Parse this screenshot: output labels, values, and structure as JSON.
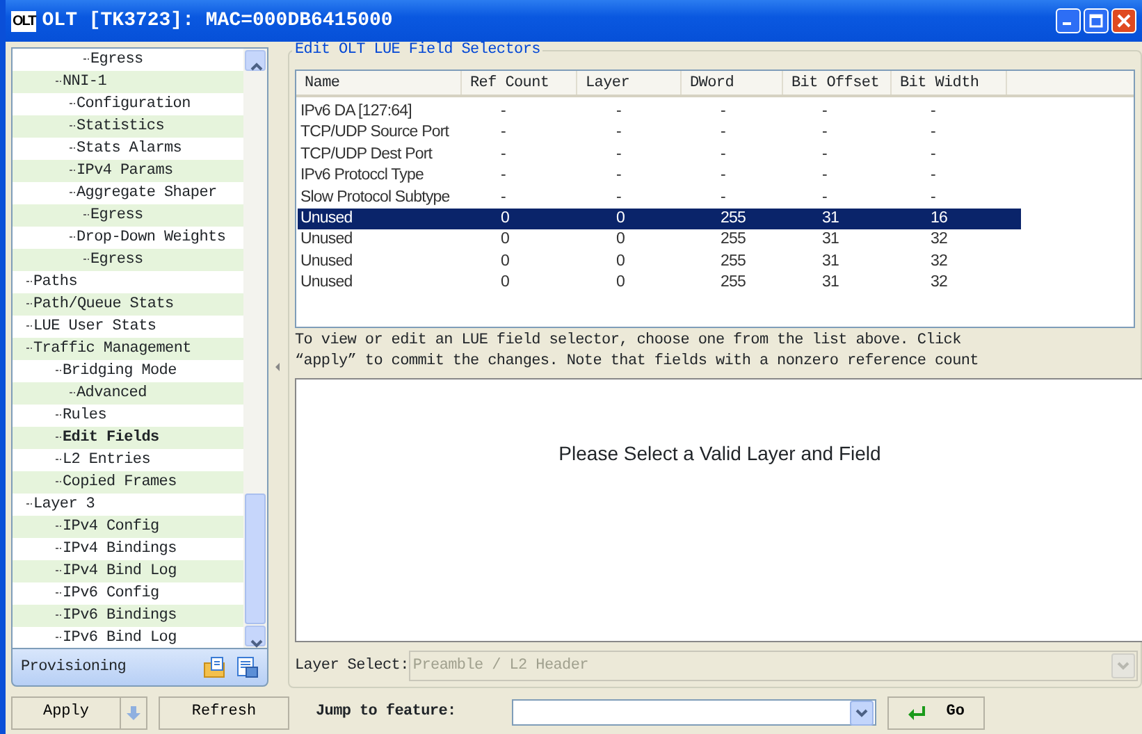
{
  "window": {
    "title": "OLT [TK3723]: MAC=000DB6415000",
    "logo": "OLT"
  },
  "tree": {
    "items": [
      {
        "children": [
          {
            "children": [
              {
                "children": [
                  {
                    "label": "Egress",
                    "selected": false
                  }
                ]
              }
            ]
          },
          {
            "label": "NNI-1",
            "selected": false,
            "children": [
              {
                "label": "Configuration",
                "selected": false
              },
              {
                "label": "Statistics",
                "selected": false
              },
              {
                "label": "Stats Alarms",
                "selected": false
              },
              {
                "label": "IPv4 Params",
                "selected": false
              },
              {
                "label": "Aggregate Shaper",
                "selected": false,
                "children": [
                  {
                    "label": "Egress",
                    "selected": false
                  }
                ]
              },
              {
                "label": "Drop-Down Weights",
                "selected": false,
                "children": [
                  {
                    "label": "Egress",
                    "selected": false
                  }
                ]
              }
            ]
          }
        ]
      },
      {
        "label": "Paths",
        "selected": false
      },
      {
        "label": "Path/Queue Stats",
        "selected": false
      },
      {
        "label": "LUE User Stats",
        "selected": false
      },
      {
        "label": "Traffic Management",
        "selected": false,
        "children": [
          {
            "label": "Bridging Mode",
            "selected": false,
            "children": [
              {
                "label": "Advanced",
                "selected": false
              }
            ]
          },
          {
            "label": "Rules",
            "selected": false
          },
          {
            "label": "Edit Fields",
            "selected": true
          },
          {
            "label": "L2 Entries",
            "selected": false
          },
          {
            "label": "Copied Frames",
            "selected": false
          }
        ]
      },
      {
        "label": "Layer 3",
        "selected": false,
        "children": [
          {
            "label": "IPv4 Config",
            "selected": false
          },
          {
            "label": "IPv4 Bindings",
            "selected": false
          },
          {
            "label": "IPv4 Bind Log",
            "selected": false
          },
          {
            "label": "IPv6 Config",
            "selected": false
          },
          {
            "label": "IPv6 Bindings",
            "selected": false
          },
          {
            "label": "IPv6 Bind Log",
            "selected": false
          }
        ]
      }
    ]
  },
  "sidebar_footer": {
    "label": "Provisioning"
  },
  "group": {
    "title": "Edit OLT LUE Field Selectors"
  },
  "table": {
    "columns": [
      "Name",
      "Ref Count",
      "Layer",
      "DWord",
      "Bit Offset",
      "Bit Width"
    ],
    "rows": [
      {
        "cells": [
          "IPv6 DA [127:64]",
          "-",
          "-",
          "-",
          "-",
          "-"
        ],
        "selected": false
      },
      {
        "cells": [
          "TCP/UDP Source Port",
          "-",
          "-",
          "-",
          "-",
          "-"
        ],
        "selected": false
      },
      {
        "cells": [
          "TCP/UDP Dest Port",
          "-",
          "-",
          "-",
          "-",
          "-"
        ],
        "selected": false
      },
      {
        "cells": [
          "IPv6 Protoccl Type",
          "-",
          "-",
          "-",
          "-",
          "-"
        ],
        "selected": false
      },
      {
        "cells": [
          "Slow Protocol Subtype",
          "-",
          "-",
          "-",
          "-",
          "-"
        ],
        "selected": false
      },
      {
        "cells": [
          "Unused",
          "0",
          "0",
          "255",
          "31",
          "16"
        ],
        "selected": true
      },
      {
        "cells": [
          "Unused",
          "0",
          "0",
          "255",
          "31",
          "32"
        ],
        "selected": false
      },
      {
        "cells": [
          "Unused",
          "0",
          "0",
          "255",
          "31",
          "32"
        ],
        "selected": false
      },
      {
        "cells": [
          "Unused",
          "0",
          "0",
          "255",
          "31",
          "32"
        ],
        "selected": false
      }
    ]
  },
  "hint": [
    "To view or edit an LUE field selector, choose one from the list above. Click",
    "“apply” to commit the changes. Note that fields with a nonzero reference count"
  ],
  "detail": {
    "message": "Please Select a Valid Layer and Field"
  },
  "layer_select": {
    "label": "Layer Select:",
    "value": "Preamble / L2 Header",
    "disabled": true
  },
  "bottom": {
    "apply": "Apply",
    "refresh": "Refresh",
    "jump_label": "Jump to feature:",
    "go": "Go"
  }
}
